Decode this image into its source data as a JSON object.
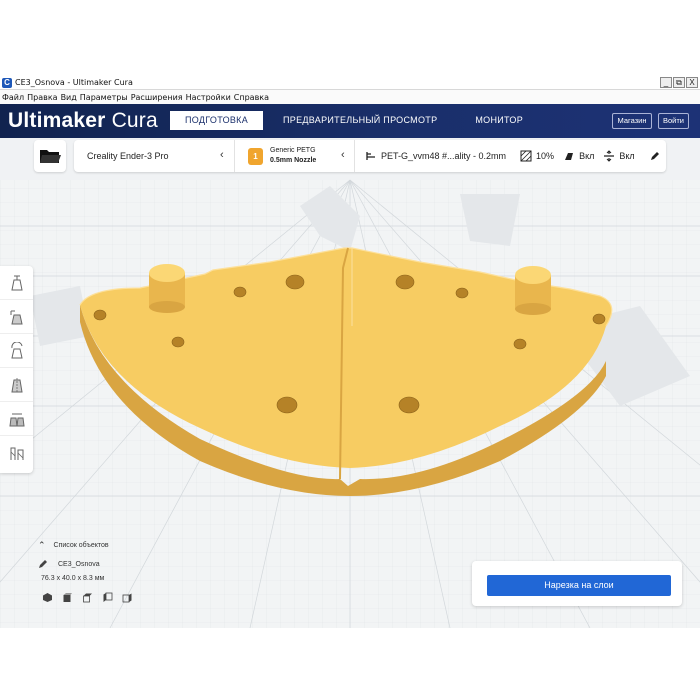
{
  "window": {
    "title": "CE3_Osnova - Ultimaker Cura",
    "app_icon_letter": "C",
    "controls": [
      "_",
      "⧉",
      "X"
    ]
  },
  "menu": {
    "items": [
      "Файл",
      "Правка",
      "Вид",
      "Параметры",
      "Расширения",
      "Настройки",
      "Справка"
    ]
  },
  "header": {
    "logo_brand": "Ultimaker",
    "logo_product": "Cura",
    "tabs": [
      {
        "label": "ПОДГОТОВКА",
        "active": true
      },
      {
        "label": "ПРЕДВАРИТЕЛЬНЫЙ ПРОСМОТР",
        "active": false
      },
      {
        "label": "МОНИТОР",
        "active": false
      }
    ],
    "store_label": "Магазин",
    "signin_label": "Войти"
  },
  "toolbar": {
    "open_icon": "folder-icon",
    "printer": "Creality Ender-3 Pro",
    "material_name": "Generic PETG",
    "nozzle": "0.5mm Nozzle",
    "material_slot": "1",
    "profile": "PET-G_vvm48 #...ality - 0.2mm",
    "infill": "10%",
    "support": "Вкл",
    "adhesion": "Вкл"
  },
  "tools": [
    "move-tool-icon",
    "scale-tool-icon",
    "rotate-tool-icon",
    "mirror-tool-icon",
    "per-model-settings-icon",
    "support-blocker-icon"
  ],
  "object_list": {
    "header": "Список объектов",
    "object_name": "CE3_Osnova",
    "dimensions": "76.3 x 40.0 x 8.3 мм",
    "view_icons": [
      "3d-view-icon",
      "front-view-icon",
      "top-view-icon",
      "left-view-icon",
      "right-view-icon"
    ]
  },
  "slice": {
    "button_label": "Нарезка на слои"
  },
  "colors": {
    "header_dark": "#11234f",
    "accent_blue": "#2167d6",
    "model_yellow": "#f6c95a",
    "model_shadow": "#d4a23a",
    "buildplate": "#eef0f2"
  }
}
